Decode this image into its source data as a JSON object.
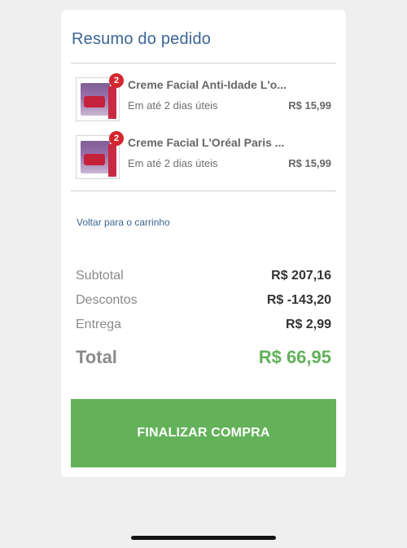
{
  "order_summary": {
    "title": "Resumo do pedido",
    "items": [
      {
        "quantity": "2",
        "name": "Creme Facial Anti-Idade L'o...",
        "delivery": "Em até 2 dias úteis",
        "price": "R$ 15,99"
      },
      {
        "quantity": "2",
        "name": "Creme Facial L'Oréal Paris ...",
        "delivery": "Em até 2 dias úteis",
        "price": "R$ 15,99"
      }
    ],
    "back_link": "Voltar para o carrinho",
    "subtotal": {
      "label": "Subtotal",
      "value": "R$ 207,16"
    },
    "discounts": {
      "label": "Descontos",
      "value": "R$ -143,20"
    },
    "shipping": {
      "label": "Entrega",
      "value": "R$ 2,99"
    },
    "total": {
      "label": "Total",
      "value": "R$ 66,95"
    },
    "finalize_button": "FINALIZAR COMPRA"
  },
  "colors": {
    "accent_green": "#63b25a",
    "title_blue": "#3b6593",
    "badge_red": "#d4262e"
  },
  "icons": {
    "product_thumbnail": "product-image-icon",
    "quantity_badge": "quantity-badge"
  }
}
